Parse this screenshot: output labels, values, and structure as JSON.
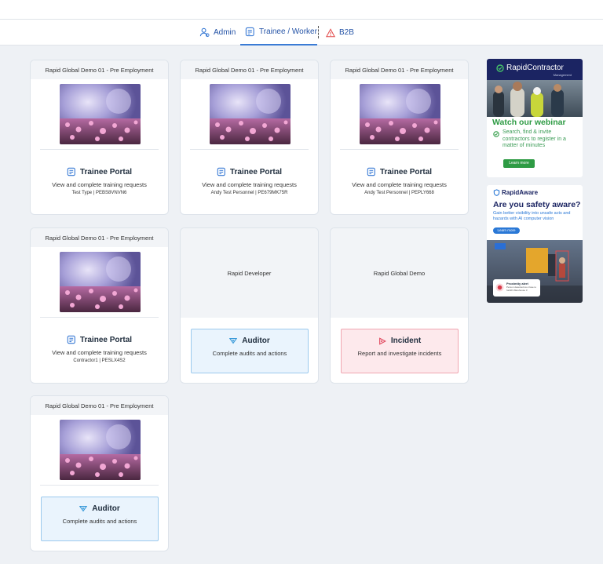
{
  "tabs": [
    {
      "label": "Admin",
      "icon": "users-icon"
    },
    {
      "label": "Trainee / Worker",
      "icon": "form-icon"
    },
    {
      "label": "B2B",
      "icon": "warning-triangle-icon"
    }
  ],
  "cards": [
    {
      "header": "Rapid Global Demo 01 - Pre Employment",
      "portal": "Trainee Portal",
      "desc": "View and complete training requests",
      "meta": "Test Type  |  PEBS8VNVN6"
    },
    {
      "header": "Rapid Global Demo 01 - Pre Employment",
      "portal": "Trainee Portal",
      "desc": "View and complete training requests",
      "meta": "Andy Test Personnel  |  PE679MK75R"
    },
    {
      "header": "Rapid Global Demo 01 - Pre Employment",
      "portal": "Trainee Portal",
      "desc": "View and complete training requests",
      "meta": "Andy Test Personnel  |  PEPLY668"
    },
    {
      "header": "Rapid Global Demo 01 - Pre Employment",
      "portal": "Trainee Portal",
      "desc": "View and complete training requests",
      "meta": "Contractor1  |  PESLX4S2"
    },
    {
      "header": "Rapid Global Demo 01 - Pre Employment",
      "auditor_title": "Auditor",
      "auditor_desc": "Complete audits and actions"
    }
  ],
  "plain_cards": [
    {
      "header": "Rapid Developer",
      "action_title": "Auditor",
      "action_desc": "Complete audits and actions"
    },
    {
      "header": "Rapid Global Demo",
      "action_title": "Incident",
      "action_desc": "Report and investigate incidents"
    }
  ],
  "ads": {
    "contractor": {
      "brand": "RapidContractor",
      "brand_sub": "Management",
      "headline": "Watch our webinar",
      "body": "Search, find & invite contractors to register in a matter of minutes",
      "cta": "Learn more"
    },
    "aware": {
      "brand": "RapidAware",
      "headline": "Are you safety aware?",
      "body": "Gain better visibility into unsafe acts and hazards with AI computer vision",
      "cta": "Learn more",
      "alert_title": "Proximity alert",
      "alert_body": "Person detected too close to forklift Warehouse 3"
    }
  },
  "colors": {
    "link": "#2453a6",
    "auditor_bg": "#eaf4fd",
    "incident_bg": "#fde9ec",
    "ad_navy": "#1b2462",
    "ad_green": "#2e9b44"
  }
}
